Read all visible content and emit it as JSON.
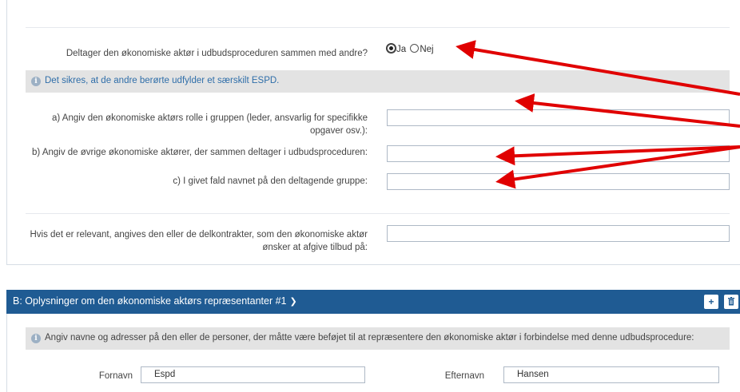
{
  "section_a": {
    "question_label": "Deltager den økonomiske aktør i udbudsproceduren sammen med andre?",
    "radio_yes": "Ja",
    "radio_no": "Nej",
    "radio_selected": "Ja",
    "info_text": "Det sikres, at de andre berørte udfylder et særskilt ESPD.",
    "field_a_label": "a) Angiv den økonomiske aktørs rolle i gruppen (leder, ansvarlig for specifikke opgaver osv.):",
    "field_a_value": "",
    "field_b_label": "b) Angiv de øvrige økonomiske aktører, der sammen deltager i udbudsproceduren:",
    "field_b_value": "",
    "field_c_label": "c) I givet fald navnet på den deltagende gruppe:",
    "field_c_value": "",
    "field_sub_label": "Hvis det er relevant, angives den eller de delkontrakter, som den økonomiske aktør ønsker at afgive tilbud på:",
    "field_sub_value": ""
  },
  "section_b": {
    "title": "B: Oplysninger om den økonomiske aktørs repræsentanter #1",
    "add_button": "+",
    "delete_button": "🗑",
    "info_text": "Angiv navne og adresser på den eller de personer, der måtte være beføjet til at repræsentere den økonomiske aktør i forbindelse med denne udbudsprocedure:",
    "firstname_label": "Fornavn",
    "firstname_value": "Espd",
    "lastname_label": "Efternavn",
    "lastname_value": "Hansen"
  },
  "colors": {
    "header_blue": "#1f5b93",
    "info_text_blue": "#2f6ea9",
    "arrow_red": "#e00000",
    "info_bar_gray": "#e3e3e3"
  },
  "icons": {
    "info": "info-circle-icon",
    "chevron": "chevron-down-icon",
    "add": "plus-icon",
    "delete": "trash-icon"
  }
}
